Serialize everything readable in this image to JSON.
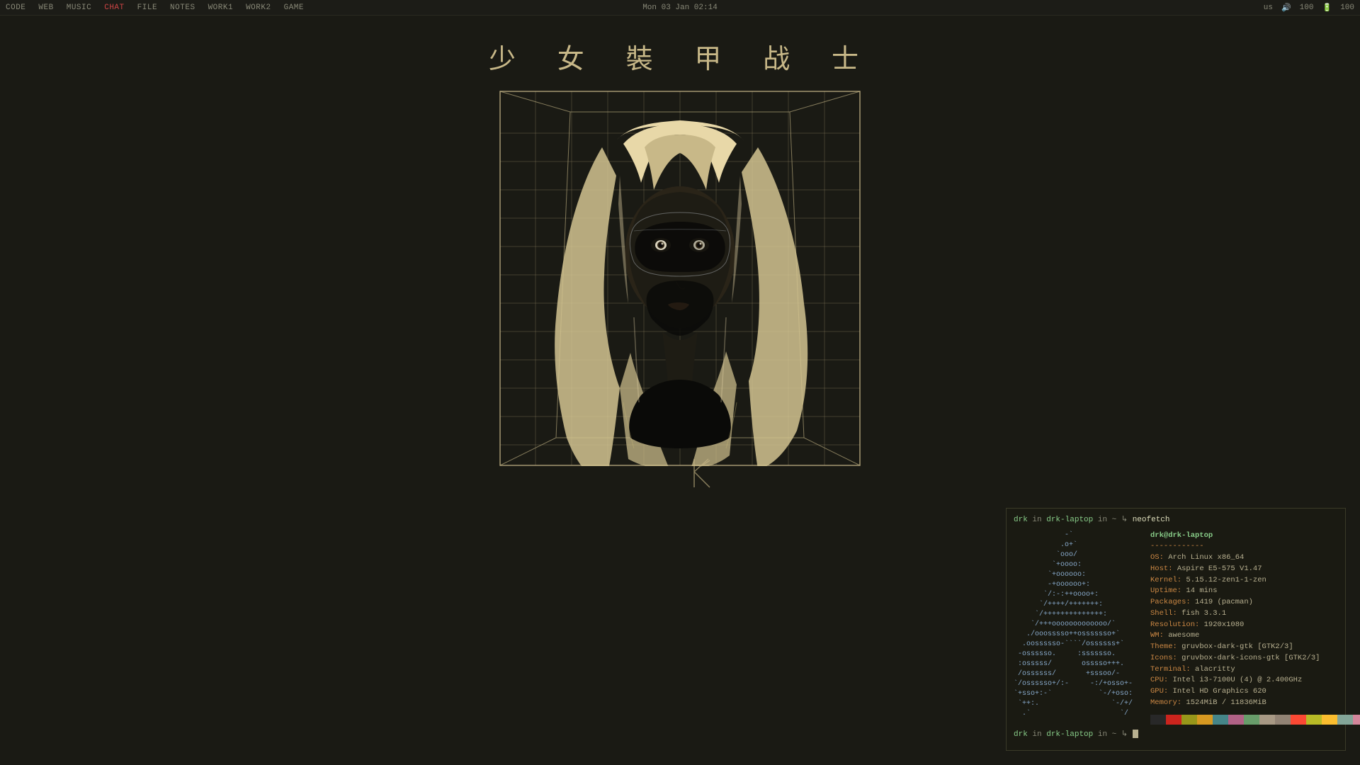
{
  "topbar": {
    "nav_items": [
      {
        "label": "CODE",
        "active": false
      },
      {
        "label": "WEB",
        "active": false
      },
      {
        "label": "MUSIC",
        "active": false
      },
      {
        "label": "CHAT",
        "active": true
      },
      {
        "label": "FILE",
        "active": false
      },
      {
        "label": "NOTES",
        "active": false
      },
      {
        "label": "WORK1",
        "active": false
      },
      {
        "label": "WORK2",
        "active": false
      },
      {
        "label": "GAME",
        "active": false
      }
    ],
    "datetime": "Mon 03 Jan 02:14",
    "locale": "us",
    "volume": "100",
    "battery": "100"
  },
  "wallpaper": {
    "kanji_title": "少 女 裝 甲 战 士"
  },
  "terminal": {
    "prompt1": "drk in drk-laptop in ~ ↳ neofetch",
    "prompt1_user": "drk",
    "prompt1_host": "drk-laptop",
    "prompt1_cmd": "neofetch",
    "username": "drk@drk-laptop",
    "separator": "------------",
    "sysinfo": [
      {
        "label": "OS:",
        "value": "Arch Linux x86_64"
      },
      {
        "label": "Host:",
        "value": "Aspire E5-575 V1.47"
      },
      {
        "label": "Kernel:",
        "value": "5.15.12-zen1-1-zen"
      },
      {
        "label": "Uptime:",
        "value": "14 mins"
      },
      {
        "label": "Packages:",
        "value": "1419 (pacman)"
      },
      {
        "label": "Shell:",
        "value": "fish 3.3.1"
      },
      {
        "label": "Resolution:",
        "value": "1920x1080"
      },
      {
        "label": "WM:",
        "value": "awesome"
      },
      {
        "label": "Theme:",
        "value": "gruvbox-dark-gtk [GTK2/3]"
      },
      {
        "label": "Icons:",
        "value": "gruvbox-dark-icons-gtk [GTK2/3]"
      },
      {
        "label": "Terminal:",
        "value": "alacritty"
      },
      {
        "label": "CPU:",
        "value": "Intel i3-7100U (4) @ 2.400GHz"
      },
      {
        "label": "GPU:",
        "value": "Intel HD Graphics 620"
      },
      {
        "label": "Memory:",
        "value": "1524MiB / 11836MiB"
      }
    ],
    "color_blocks": [
      "#282828",
      "#cc241d",
      "#98971a",
      "#d79921",
      "#458588",
      "#b16286",
      "#689d6a",
      "#a89984",
      "#928374",
      "#fb4934",
      "#b8bb26",
      "#fabd2f",
      "#83a598",
      "#d3869b",
      "#8ec07c",
      "#ebdbb2"
    ],
    "prompt2": "drk in drk-laptop in ~ ↳",
    "prompt2_user": "drk",
    "prompt2_host": "drk-laptop"
  }
}
